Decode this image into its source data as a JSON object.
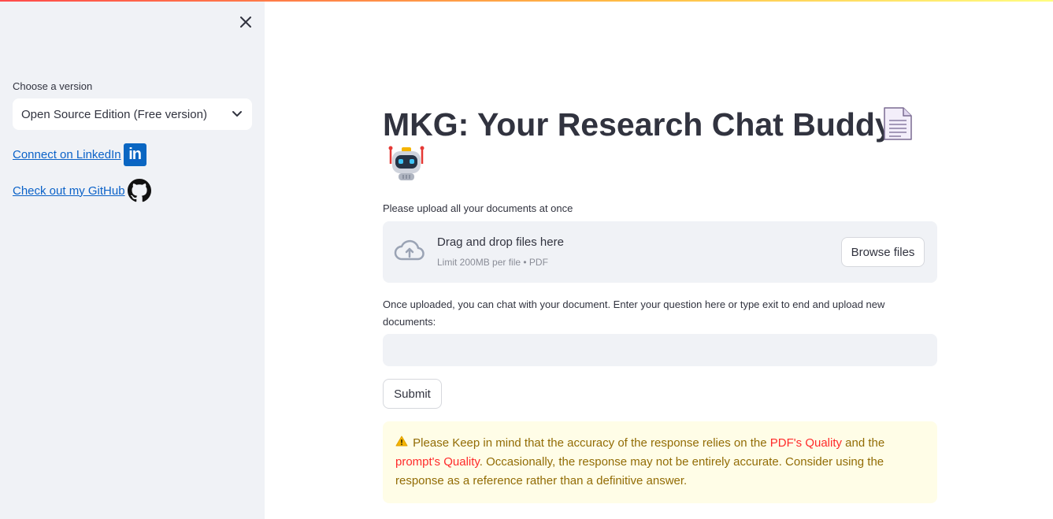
{
  "sidebar": {
    "version_label": "Choose a version",
    "version_selected": "Open Source Edition (Free version)",
    "links": [
      {
        "text": "Connect on LinkedIn"
      },
      {
        "text": "Check out my GitHub"
      }
    ]
  },
  "main": {
    "title": "MKG: Your Research Chat Buddy",
    "upload_label": "Please upload all your documents at once",
    "dropzone": {
      "title": "Drag and drop files here",
      "subtitle": "Limit 200MB per file • PDF",
      "browse_label": "Browse files"
    },
    "question_label": "Once uploaded, you can chat with your document. Enter your question here or type exit to end and upload new documents:",
    "question_value": "",
    "submit_label": "Submit",
    "warning": {
      "part1": "Please Keep in mind that the accuracy of the response relies on the ",
      "highlight1": "PDF's Quality",
      "part2": " and the ",
      "highlight2": "prompt's Quality",
      "part3": ". Occasionally, the response may not be entirely accurate. Consider using the response as a reference rather than a definitive answer."
    }
  },
  "icons": {
    "close": "close-icon",
    "chevron": "chevron-down-icon",
    "linkedin": "linkedin-icon",
    "github": "github-icon",
    "cloud": "cloud-upload-icon",
    "warning": "warning-icon",
    "document_emoji": "page-icon",
    "robot_emoji": "robot-icon"
  },
  "colors": {
    "sidebar_bg": "#f0f2f6",
    "link": "#0b62c8",
    "warning_text": "#926c05",
    "warning_bg": "#fffde7",
    "highlight": "#ff2b2b"
  }
}
